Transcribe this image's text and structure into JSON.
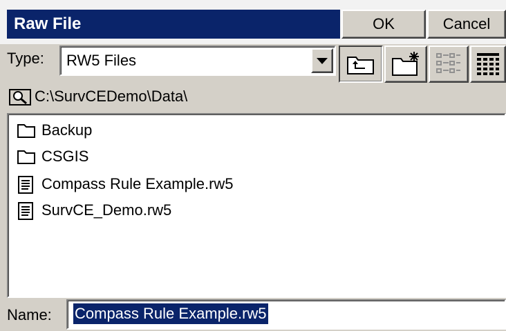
{
  "dialog": {
    "title": "Raw File",
    "ok_label": "OK",
    "cancel_label": "Cancel"
  },
  "type_row": {
    "label": "Type:",
    "selected": "RW5 Files"
  },
  "path": {
    "text": "C:\\SurvCEDemo\\Data\\"
  },
  "files": [
    {
      "name": "Backup",
      "kind": "folder-icon"
    },
    {
      "name": "CSGIS",
      "kind": "folder-icon"
    },
    {
      "name": "Compass Rule Example.rw5",
      "kind": "file-icon"
    },
    {
      "name": "SurvCE_Demo.rw5",
      "kind": "file-icon"
    }
  ],
  "name_row": {
    "label": "Name:",
    "value": "Compass Rule Example.rw5"
  },
  "colors": {
    "title_bar": "#0a246a",
    "selection": "#0a246a",
    "face": "#d4d0c8"
  }
}
